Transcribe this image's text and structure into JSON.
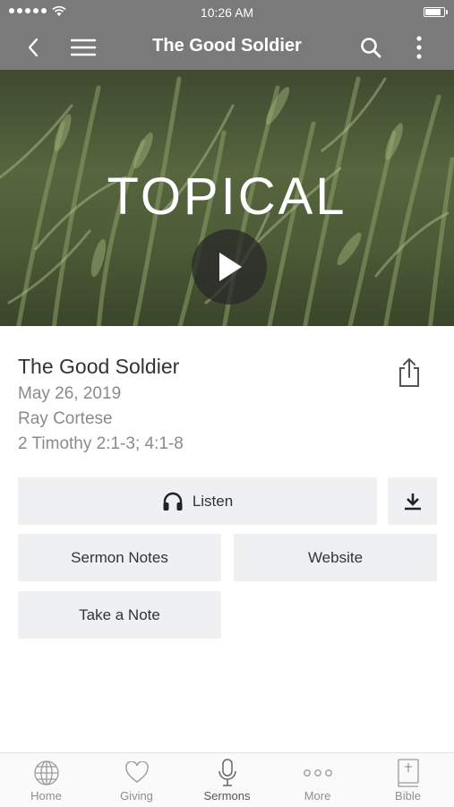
{
  "status_bar": {
    "time": "10:26 AM"
  },
  "nav": {
    "title": "The Good Soldier"
  },
  "hero": {
    "overlay_text": "TOPICAL"
  },
  "sermon": {
    "title": "The Good Soldier",
    "date": "May 26, 2019",
    "speaker": "Ray Cortese",
    "scripture": "2 Timothy 2:1-3; 4:1-8"
  },
  "actions": {
    "listen_label": "Listen",
    "sermon_notes_label": "Sermon Notes",
    "website_label": "Website",
    "take_note_label": "Take a Note"
  },
  "tabs": [
    {
      "label": "Home",
      "icon": "globe-icon",
      "active": false
    },
    {
      "label": "Giving",
      "icon": "heart-icon",
      "active": false
    },
    {
      "label": "Sermons",
      "icon": "microphone-icon",
      "active": true
    },
    {
      "label": "More",
      "icon": "more-dots-icon",
      "active": false
    },
    {
      "label": "Bible",
      "icon": "bible-icon",
      "active": false
    }
  ],
  "colors": {
    "header": "#7a7a7a",
    "button_bg": "#eef0f1",
    "muted_text": "#8a8a8a"
  }
}
